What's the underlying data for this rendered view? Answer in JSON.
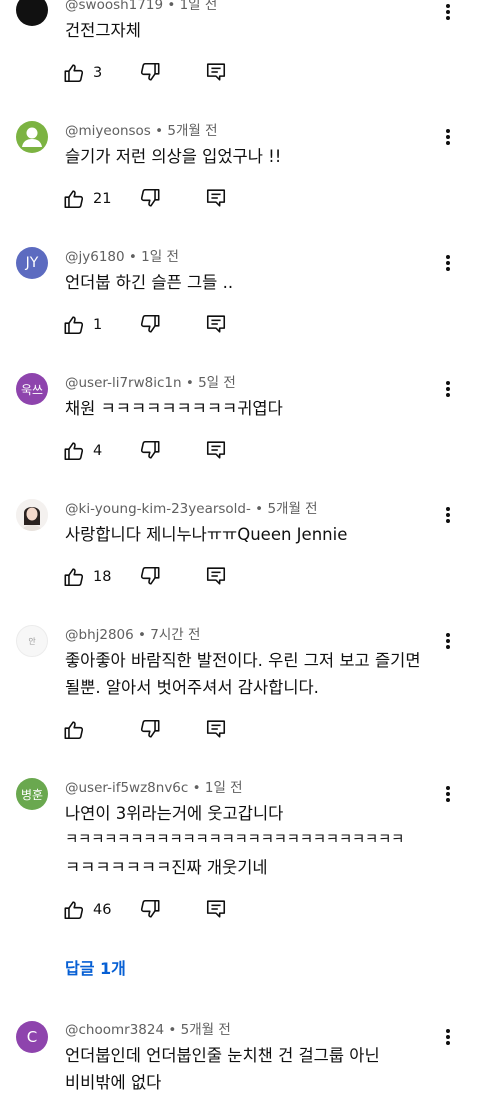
{
  "comments": [
    {
      "author": "@swoosh1719",
      "time": "1일 전",
      "lines": [
        "건전그자체"
      ],
      "likes": "3",
      "avatar_color": "#111111",
      "avatar_text": ""
    },
    {
      "author": "@miyeonsos",
      "time": "5개월 전",
      "lines": [
        "슬기가 저런 의상을 입었구나 !!"
      ],
      "likes": "21",
      "avatar_color": "#7cb342",
      "avatar_text": ""
    },
    {
      "author": "@jy6180",
      "time": "1일 전",
      "lines": [
        "언더붑 하긴 슬픈 그들 .."
      ],
      "likes": "1",
      "avatar_color": "#5c6bc0",
      "avatar_text": "JY"
    },
    {
      "author": "@user-li7rw8ic1n",
      "time": "5일 전",
      "lines": [
        "채원 ㅋㅋㅋㅋㅋㅋㅋㅋㅋ귀엽다"
      ],
      "likes": "4",
      "avatar_color": "#8e44ad",
      "avatar_text": "욱쓰"
    },
    {
      "author": "@ki-young-kim-23yearsold-",
      "time": "5개월 전",
      "lines": [
        "사랑합니다 제니누나ㅠㅠQueen Jennie"
      ],
      "likes": "18",
      "avatar_color": "#f2f2f2",
      "avatar_text": ""
    },
    {
      "author": "@bhj2806",
      "time": "7시간 전",
      "lines": [
        "좋아좋아 바람직한 발전이다. 우린 그저 보고 즐기면",
        "될뿐. 알아서 벗어주셔서 감사합니다."
      ],
      "likes": "",
      "avatar_color": "#f7f7f7",
      "avatar_text": "안"
    },
    {
      "author": "@user-if5wz8nv6c",
      "time": "1일 전",
      "lines": [
        "나연이 3위라는거에 웃고갑니다",
        "ㅋㅋㅋㅋㅋㅋㅋㅋㅋㅋㅋㅋㅋㅋㅋㅋㅋㅋㅋㅋㅋㅋㅋㅋㅋㅋ",
        "ㅋㅋㅋㅋㅋㅋㅋ진짜 개웃기네"
      ],
      "likes": "46",
      "avatar_color": "#6aa84f",
      "avatar_text": "병훈"
    },
    {
      "author": "@choomr3824",
      "time": "5개월 전",
      "lines": [
        "언더붑인데 언더붑인줄 눈치챈 건 걸그룹 아닌",
        "비비밖에 없다"
      ],
      "likes": "",
      "avatar_color": "#8e44ad",
      "avatar_text": "C"
    }
  ],
  "replies_link": "답글 1개",
  "icons": {
    "like": "thumbs-up-icon",
    "dislike": "thumbs-down-icon",
    "reply": "reply-comment-icon",
    "more": "more-vertical-icon"
  },
  "colors": {
    "text": "#0f0f0f",
    "meta": "#606060",
    "link": "#065fd4"
  }
}
